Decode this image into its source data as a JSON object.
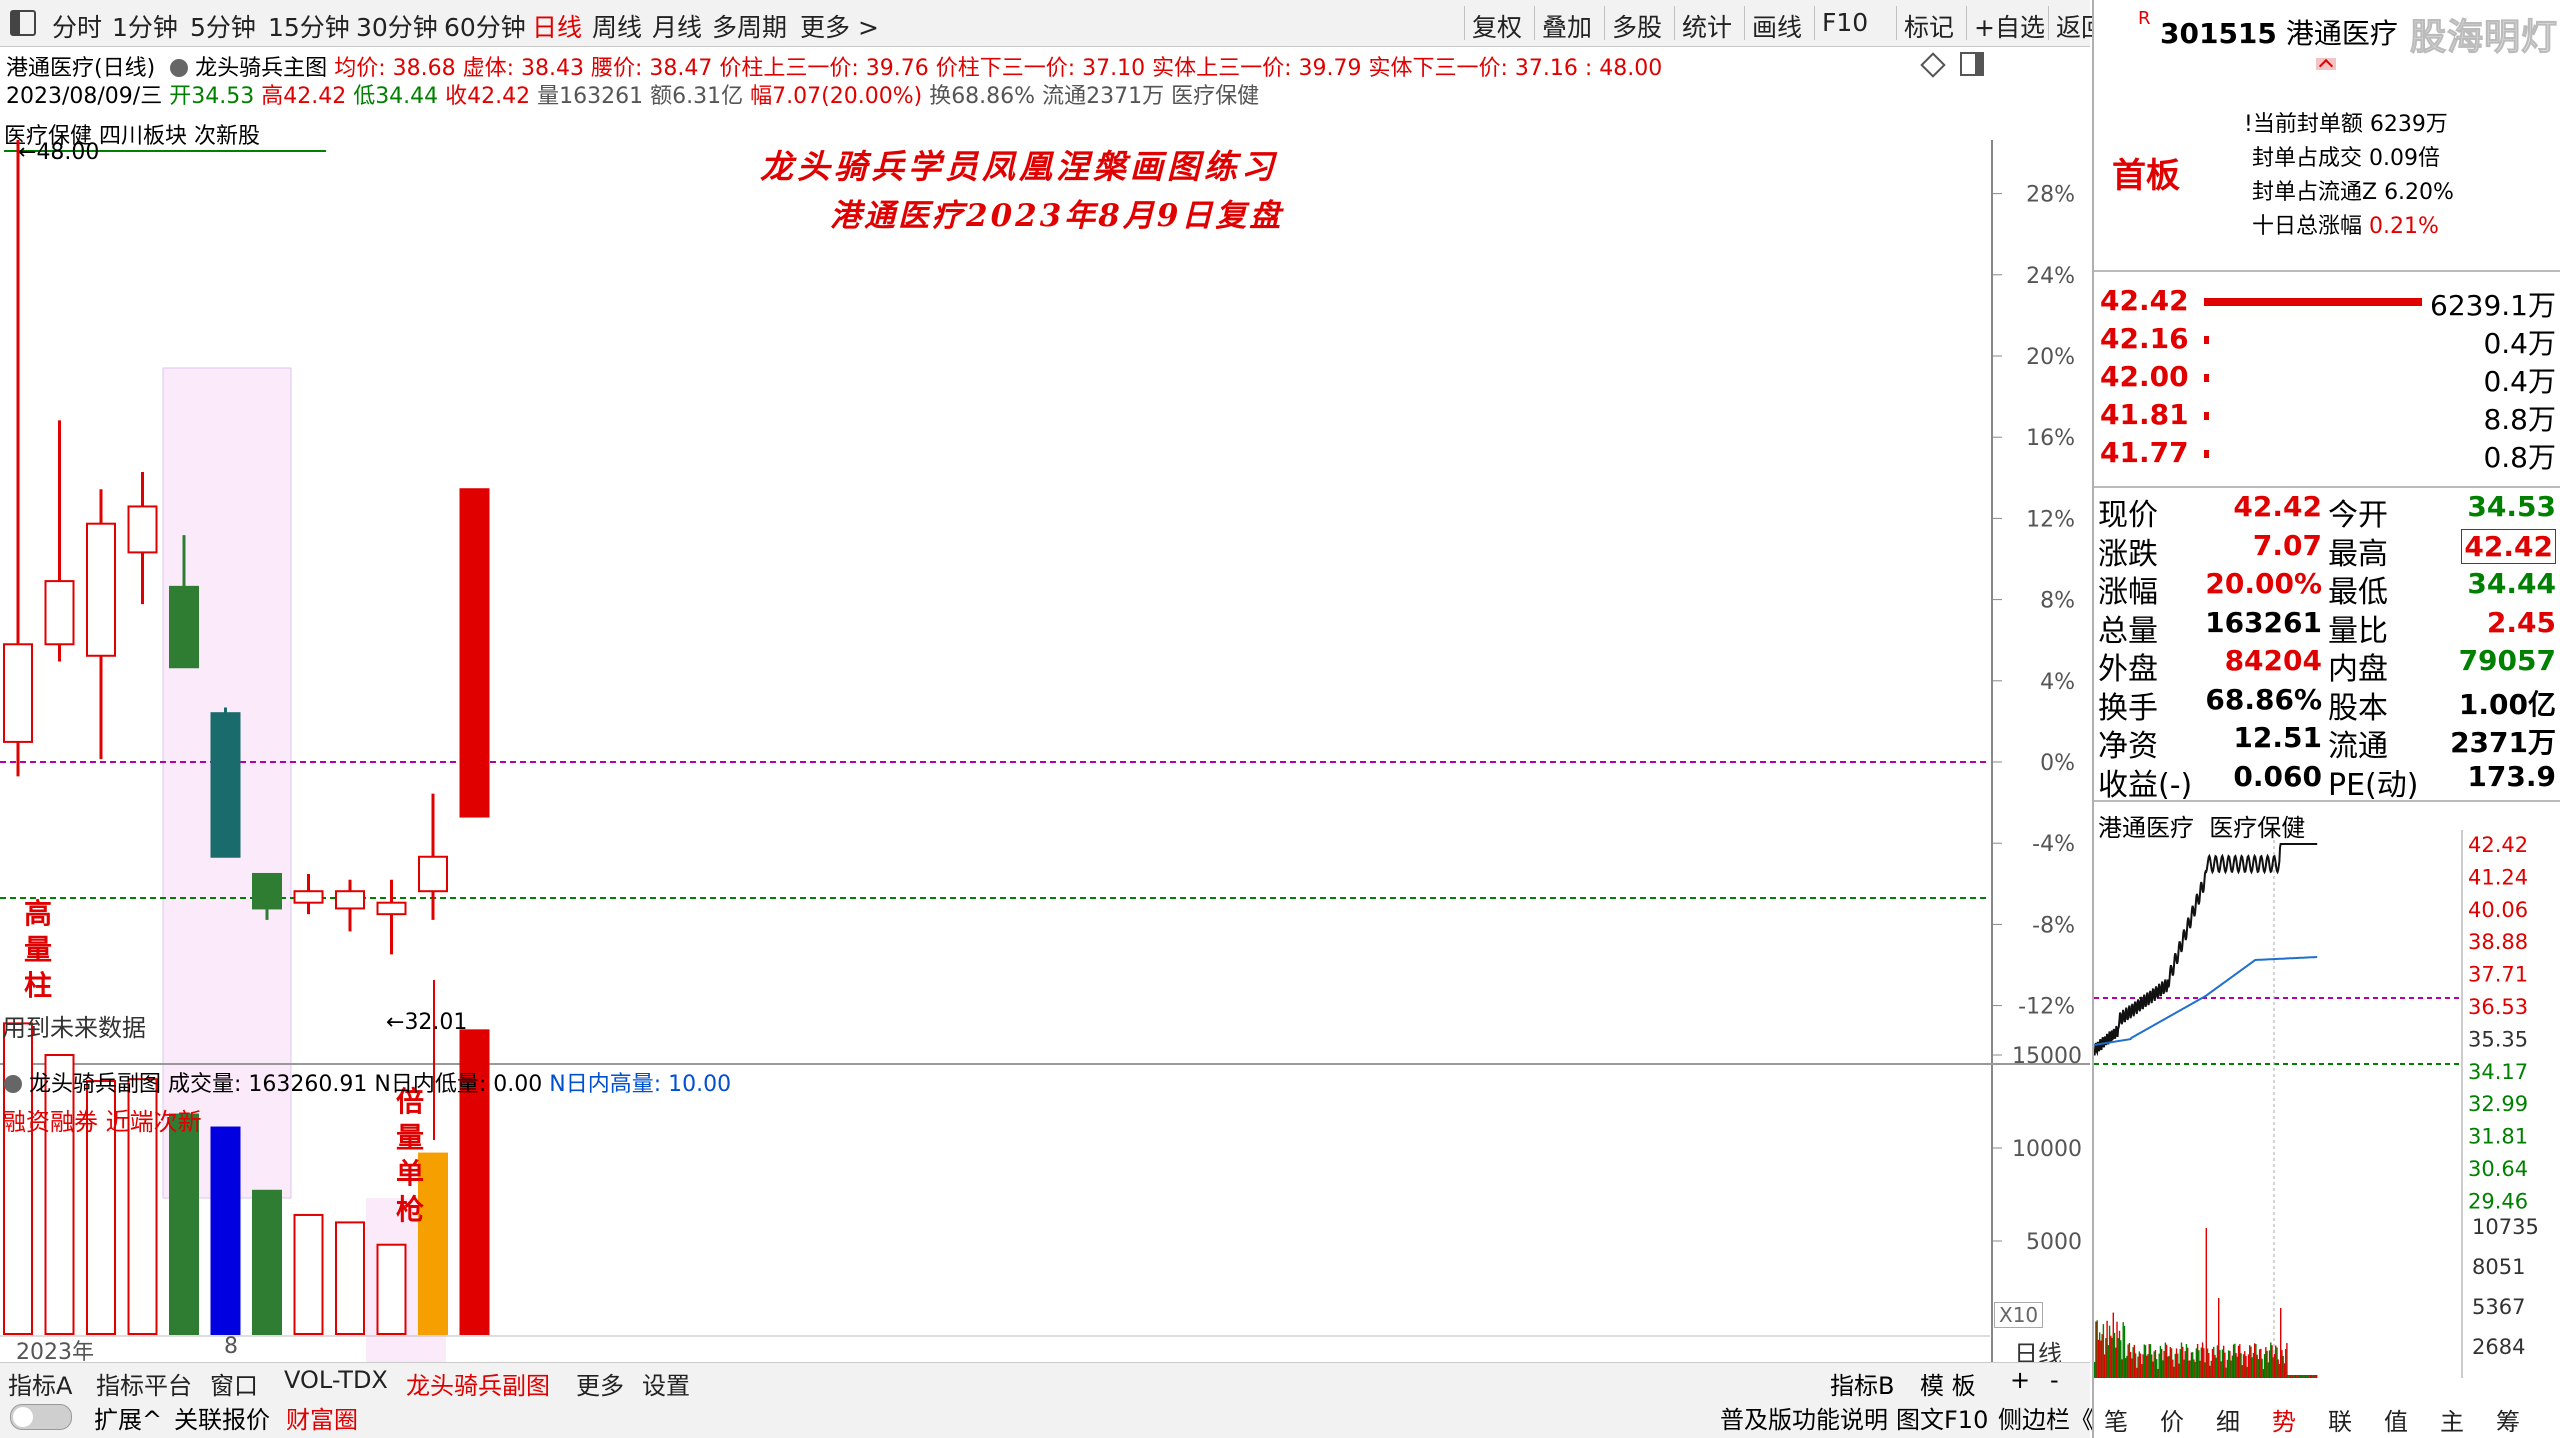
{
  "periods": [
    {
      "label": "分时",
      "active": false
    },
    {
      "label": "1分钟",
      "active": false
    },
    {
      "label": "5分钟",
      "active": false
    },
    {
      "label": "15分钟",
      "active": false
    },
    {
      "label": "30分钟",
      "active": false
    },
    {
      "label": "60分钟",
      "active": false
    },
    {
      "label": "日线",
      "active": true
    },
    {
      "label": "周线",
      "active": false
    },
    {
      "label": "月线",
      "active": false
    },
    {
      "label": "多周期",
      "active": false
    },
    {
      "label": "更多 >",
      "active": false
    }
  ],
  "toolbar": [
    "复权",
    "叠加",
    "多股",
    "统计",
    "画线",
    "F10",
    "标记",
    "+自选",
    "返回"
  ],
  "header": {
    "stock_title": "港通医疗(日线)",
    "chart_name": "龙头骑兵主图",
    "indicators": "均价: 38.68  虚体: 38.43  腰价: 38.47  价柱上三一价: 39.76  价柱下三一价: 37.10  实体上三一价: 39.79  实体下三一价: 37.16 : 48.00",
    "date": "2023/08/09/三",
    "open": "开34.53",
    "high": "高42.42",
    "low": "低34.44",
    "close": "收42.42",
    "volume": "量163261",
    "amount": "额6.31亿",
    "change": "幅7.07(20.00%)",
    "turnover": "换68.86%",
    "float": "流通2371万",
    "sector": "医疗保健",
    "tags": "医疗保健 四川板块 次新股"
  },
  "chart_title_line1": "龙头骑兵学员凤凰涅槃画图练习",
  "chart_title_line2": "港通医疗2023年8月9日复盘",
  "annotations": {
    "high_label": "48.00",
    "low_label": "32.01",
    "future_data": "用到未来数据",
    "high_volume": "高量柱",
    "double_volume": "倍量单枪",
    "margin_note": "融资融券 近端次新"
  },
  "chart_data": {
    "type": "candlestick",
    "price_axis_pct": [
      "28%",
      "24%",
      "20%",
      "16%",
      "12%",
      "8%",
      "4%",
      "0%",
      "-4%",
      "-8%",
      "-12%"
    ],
    "base_price": 35.35,
    "candles": [
      {
        "open": 35.7,
        "close": 37.4,
        "high": 48.0,
        "low": 35.1,
        "color": "red"
      },
      {
        "open": 37.4,
        "close": 38.5,
        "high": 41.3,
        "low": 37.1,
        "color": "red"
      },
      {
        "open": 37.2,
        "close": 39.5,
        "high": 40.1,
        "low": 35.4,
        "color": "red"
      },
      {
        "open": 39.0,
        "close": 39.8,
        "high": 40.4,
        "low": 38.1,
        "color": "red"
      },
      {
        "open": 38.4,
        "close": 37.0,
        "high": 39.3,
        "low": 37.0,
        "color": "green"
      },
      {
        "open": 36.2,
        "close": 33.7,
        "high": 36.3,
        "low": 33.7,
        "color": "darkcyan"
      },
      {
        "open": 33.4,
        "close": 32.8,
        "high": 33.4,
        "low": 32.6,
        "color": "green"
      },
      {
        "open": 32.9,
        "close": 33.1,
        "high": 33.4,
        "low": 32.7,
        "color": "red"
      },
      {
        "open": 32.8,
        "close": 33.1,
        "high": 33.3,
        "low": 32.4,
        "color": "red"
      },
      {
        "open": 32.7,
        "close": 32.9,
        "high": 33.3,
        "low": 32.0,
        "color": "red"
      },
      {
        "open": 33.1,
        "close": 33.7,
        "high": 34.8,
        "low": 32.6,
        "color": "red"
      },
      {
        "open": 34.4,
        "close": 40.1,
        "high": 40.1,
        "low": 34.4,
        "color": "red"
      }
    ],
    "volumes": [
      {
        "value": 16700,
        "color": "red"
      },
      {
        "value": 15000,
        "color": "red"
      },
      {
        "value": 13600,
        "color": "red"
      },
      {
        "value": 13700,
        "color": "red"
      },
      {
        "value": 11800,
        "color": "green"
      },
      {
        "value": 11100,
        "color": "blue"
      },
      {
        "value": 7700,
        "color": "green"
      },
      {
        "value": 6400,
        "color": "red"
      },
      {
        "value": 6000,
        "color": "red"
      },
      {
        "value": 4800,
        "color": "red"
      },
      {
        "value": 9700,
        "color": "orange"
      },
      {
        "value": 16326,
        "color": "red"
      }
    ],
    "volume_axis": [
      "15000",
      "10000",
      "5000"
    ],
    "volume_scale": "X10",
    "x_labels": [
      "2023年",
      "8"
    ],
    "period": "日线"
  },
  "subchart": {
    "name": "龙头骑兵副图",
    "volume_text": "成交量: 163260.91",
    "low_vol": "N日内低量: 0.00",
    "high_vol": "N日内高量: 10.00"
  },
  "quote": {
    "code": "301515",
    "name": "港通医疗",
    "watermark": "股海明灯",
    "board": "首板",
    "seal_amount": "当前封单额 6239万",
    "seal_trade": "封单占成交 0.09倍",
    "seal_float": "封单占流通Z 6.20%",
    "ten_day": "十日总涨幅",
    "ten_day_val": "0.21%",
    "bids": [
      {
        "price": "42.42",
        "vol": "6239.1万"
      },
      {
        "price": "42.16",
        "vol": "0.4万"
      },
      {
        "price": "42.00",
        "vol": "0.4万"
      },
      {
        "price": "41.81",
        "vol": "8.8万"
      },
      {
        "price": "41.77",
        "vol": "0.8万"
      }
    ],
    "stats": [
      {
        "l1": "现价",
        "v1": "42.42",
        "c1": "red",
        "l2": "今开",
        "v2": "34.53",
        "c2": "green"
      },
      {
        "l1": "涨跌",
        "v1": "7.07",
        "c1": "red",
        "l2": "最高",
        "v2": "42.42",
        "c2": "red"
      },
      {
        "l1": "涨幅",
        "v1": "20.00%",
        "c1": "red",
        "l2": "最低",
        "v2": "34.44",
        "c2": "green"
      },
      {
        "l1": "总量",
        "v1": "163261",
        "c1": "dk",
        "l2": "量比",
        "v2": "2.45",
        "c2": "red"
      },
      {
        "l1": "外盘",
        "v1": "84204",
        "c1": "red",
        "l2": "内盘",
        "v2": "79057",
        "c2": "green"
      },
      {
        "l1": "换手",
        "v1": "68.86%",
        "c1": "dk",
        "l2": "股本",
        "v2": "1.00亿",
        "c2": "dk"
      },
      {
        "l1": "净资",
        "v1": "12.51",
        "c1": "dk",
        "l2": "流通",
        "v2": "2371万",
        "c2": "dk"
      },
      {
        "l1": "收益(-)",
        "v1": "0.060",
        "c1": "dk",
        "l2": "PE(动)",
        "v2": "173.9",
        "c2": "dk"
      }
    ],
    "mini_title": "港通医疗  医疗保健",
    "mini_axis": [
      "42.42",
      "41.24",
      "40.06",
      "38.88",
      "37.71",
      "36.53",
      "35.35",
      "34.17",
      "32.99",
      "31.81",
      "30.64",
      "29.46"
    ],
    "mini_vol_axis": [
      "10735",
      "8051",
      "5367",
      "2684"
    ]
  },
  "bottom_tabs": [
    "指标A",
    "指标平台",
    "窗口",
    "VOL-TDX",
    "龙头骑兵副图",
    "更多",
    "设置"
  ],
  "bottom_right_tabs": [
    "指标B",
    "模 板",
    "+",
    "-"
  ],
  "status_left": [
    "扩展^",
    "关联报价",
    "财富圈"
  ],
  "status_right": [
    "普及版功能说明",
    "图文F10",
    "侧边栏《"
  ],
  "right_tabs": [
    "笔",
    "价",
    "细",
    "势",
    "联",
    "值",
    "主",
    "筹"
  ],
  "colors": {
    "up": "#e00000",
    "down": "#006400",
    "accent": "#e00000"
  }
}
